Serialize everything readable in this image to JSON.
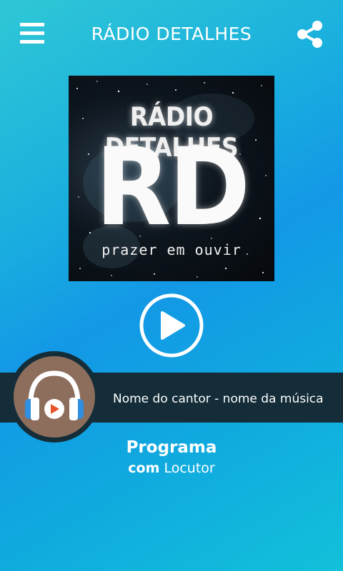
{
  "appbar": {
    "title": "RÁDIO DETALHES",
    "menu_icon": "hamburger-menu-icon",
    "share_icon": "share-icon"
  },
  "cover": {
    "name": "RÁDIO DETALHES",
    "monogram": "RD",
    "slogan": "prazer em ouvir"
  },
  "player": {
    "play_icon": "play-icon",
    "now_playing": "Nome do cantor - nome da música",
    "avatar_icon": "headphones-play-icon"
  },
  "program": {
    "title": "Programa",
    "host_prefix": "com",
    "host_name": "Locutor"
  },
  "colors": {
    "bg_start": "#2fc7d6",
    "bg_mid": "#1398e6",
    "track_bar": "#142d38",
    "avatar_bg": "#8d6e5d",
    "icon_orange": "#e8542c",
    "icon_blue": "#2f8fe0"
  }
}
